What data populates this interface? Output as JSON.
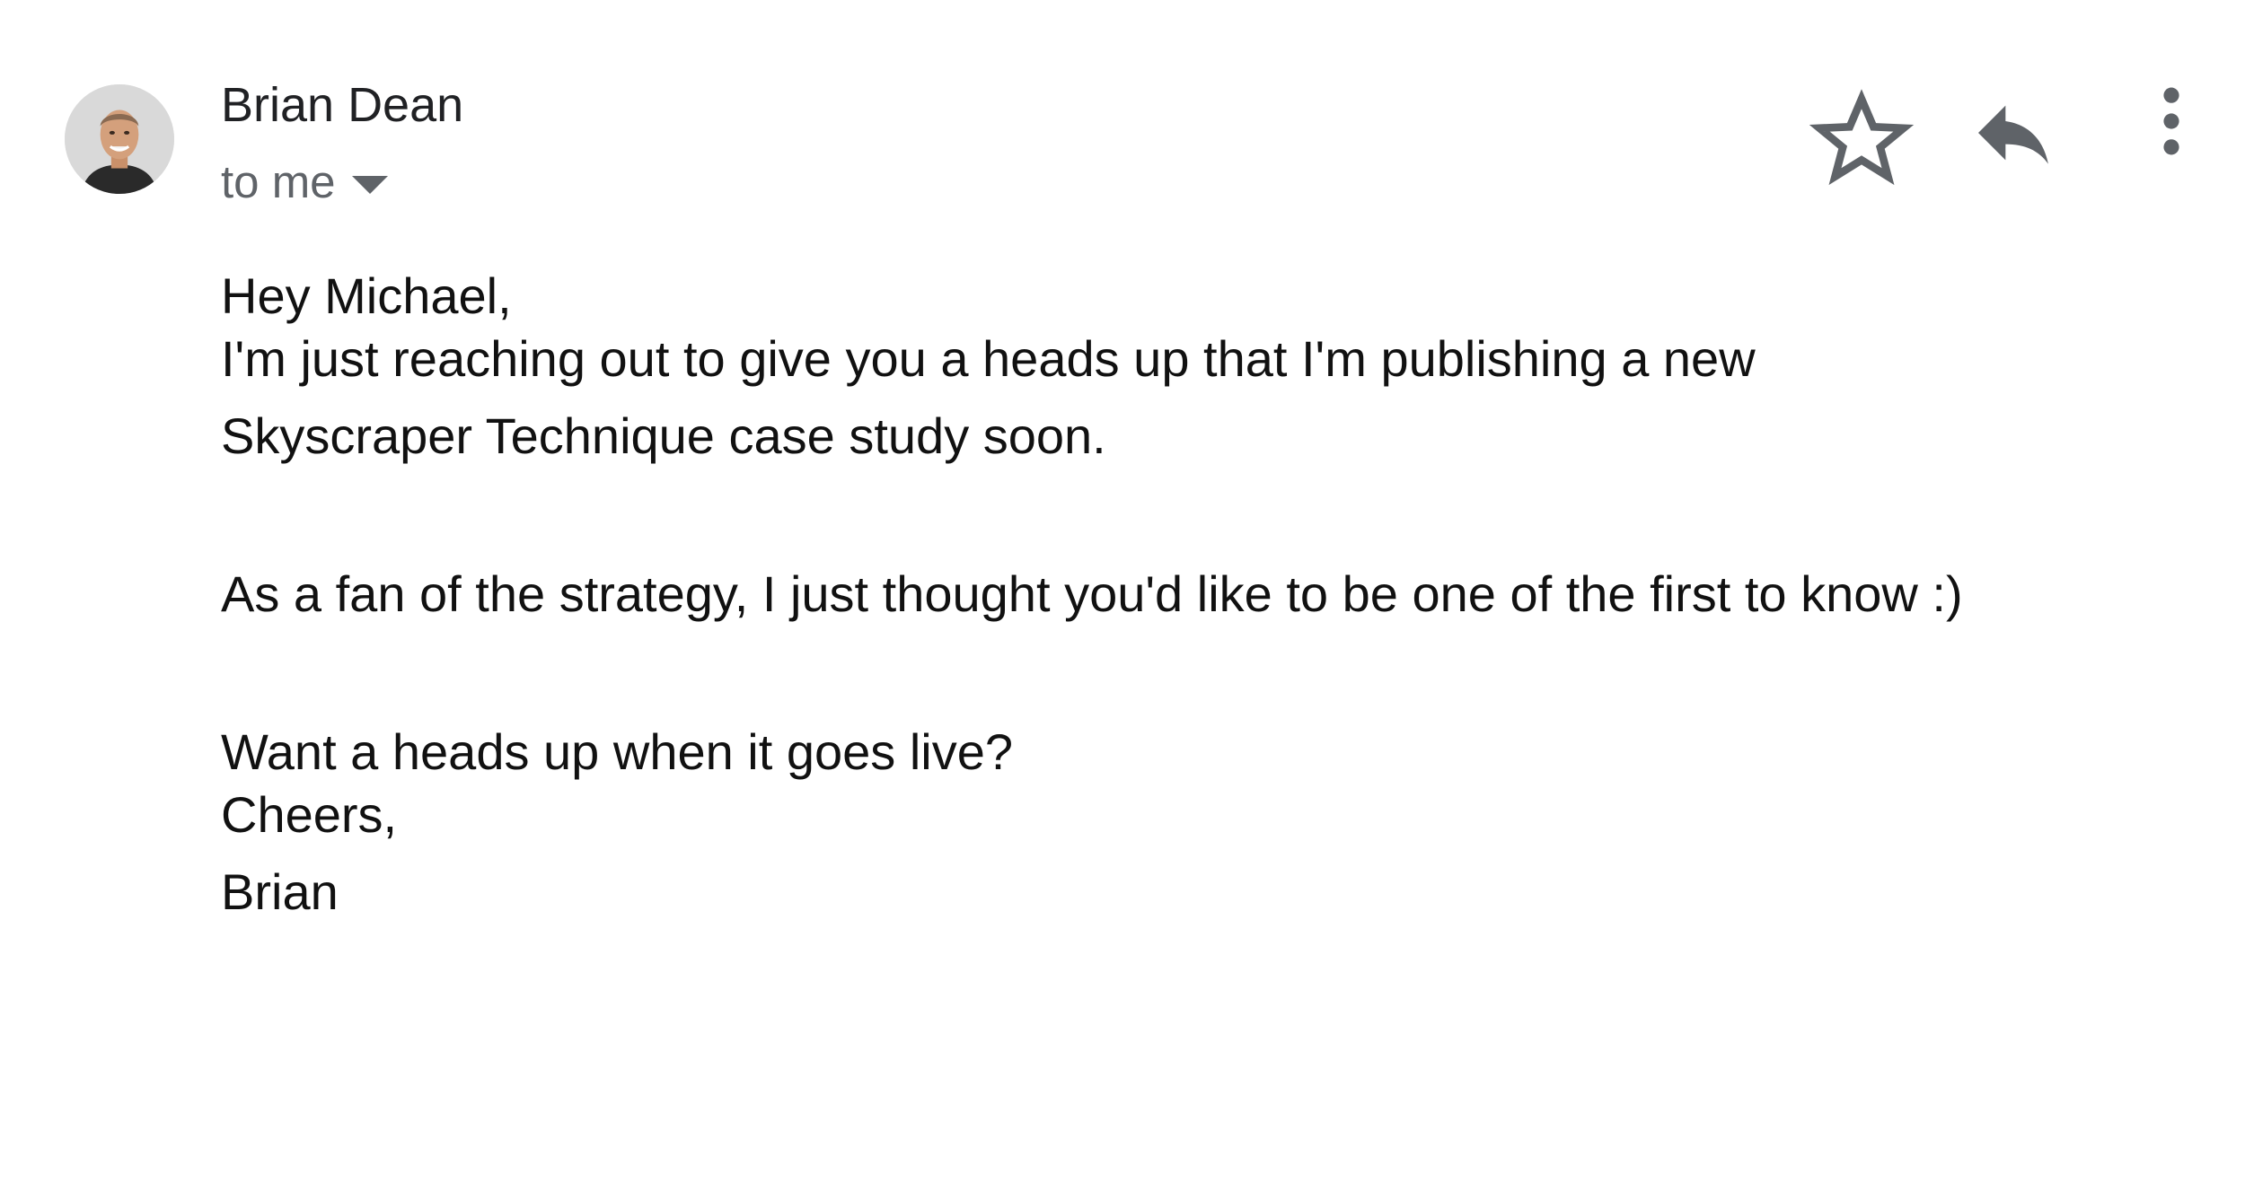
{
  "sender": {
    "name": "Brian Dean",
    "recipient_label": "to me"
  },
  "actions": {
    "star_icon": "star-icon",
    "reply_icon": "reply-icon",
    "more_icon": "more-vertical-icon"
  },
  "message": {
    "greeting": "Hey Michael,",
    "paragraph1_line1": "I'm just reaching out to give you a heads up that I'm publishing a new",
    "paragraph1_line2": "Skyscraper Technique case study soon.",
    "paragraph2": "As a fan of the strategy, I just thought you'd like to be one of the first to know :)",
    "paragraph3": "Want a heads up when it goes live?",
    "signoff": "Cheers,",
    "signature": "Brian"
  },
  "colors": {
    "icon_gray": "#5f6368",
    "text": "#111111"
  }
}
